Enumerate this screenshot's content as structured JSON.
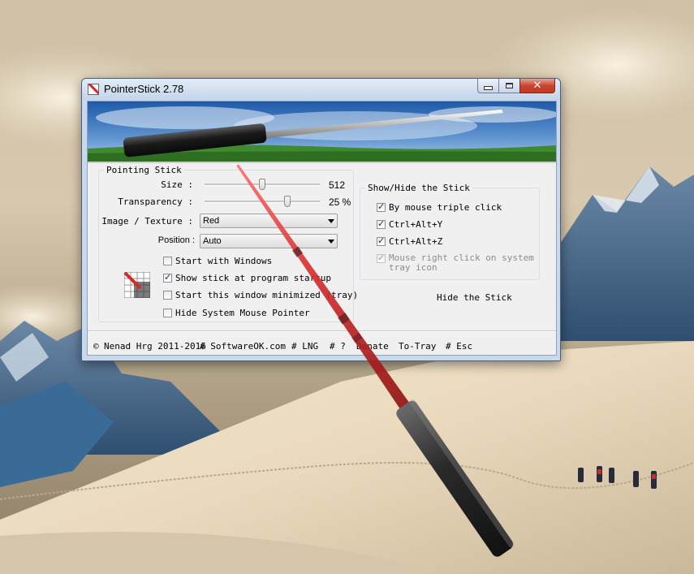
{
  "window": {
    "title": "PointerStick 2.78",
    "minimize_label": "Minimize",
    "maximize_label": "Maximize",
    "close_label": "Close"
  },
  "pointing_stick": {
    "group_title": "Pointing Stick",
    "size": {
      "label": "Size :",
      "value": "512",
      "fraction": 0.5
    },
    "transparency": {
      "label": "Transparency :",
      "value": "25 %",
      "fraction": 0.72
    },
    "image_texture": {
      "label": "Image / Texture :",
      "value": "Red"
    },
    "position": {
      "label": "Position :",
      "value": "Auto"
    },
    "options": [
      {
        "label": "Start with Windows",
        "checked": false
      },
      {
        "label": "Show stick at program startup",
        "checked": true
      },
      {
        "label": "Start this window minimized (tray)",
        "checked": false
      },
      {
        "label": "Hide System Mouse Pointer",
        "checked": false
      }
    ]
  },
  "show_hide": {
    "group_title": "Show/Hide the Stick",
    "options": [
      {
        "label": "By mouse triple click",
        "checked": true,
        "disabled": false
      },
      {
        "label": "Ctrl+Alt+Y",
        "checked": true,
        "disabled": false
      },
      {
        "label": "Ctrl+Alt+Z",
        "checked": true,
        "disabled": false
      },
      {
        "label": "Mouse right click on system",
        "label2": "tray icon",
        "checked": true,
        "disabled": true
      }
    ],
    "hide_button": "Hide the Stick"
  },
  "statusbar": {
    "copyright_symbol": "©",
    "author": "Nenad Hrg 2011-2016",
    "website": "# SoftwareOK.com",
    "lng": "# LNG",
    "help": "# ?",
    "donate": "Donate",
    "to_tray": "To-Tray",
    "esc": "# Esc"
  },
  "colors": {
    "stick_red": "#d42a2a",
    "stick_handle": "#2b2b2b",
    "titlebar": "#c9d9ec"
  }
}
